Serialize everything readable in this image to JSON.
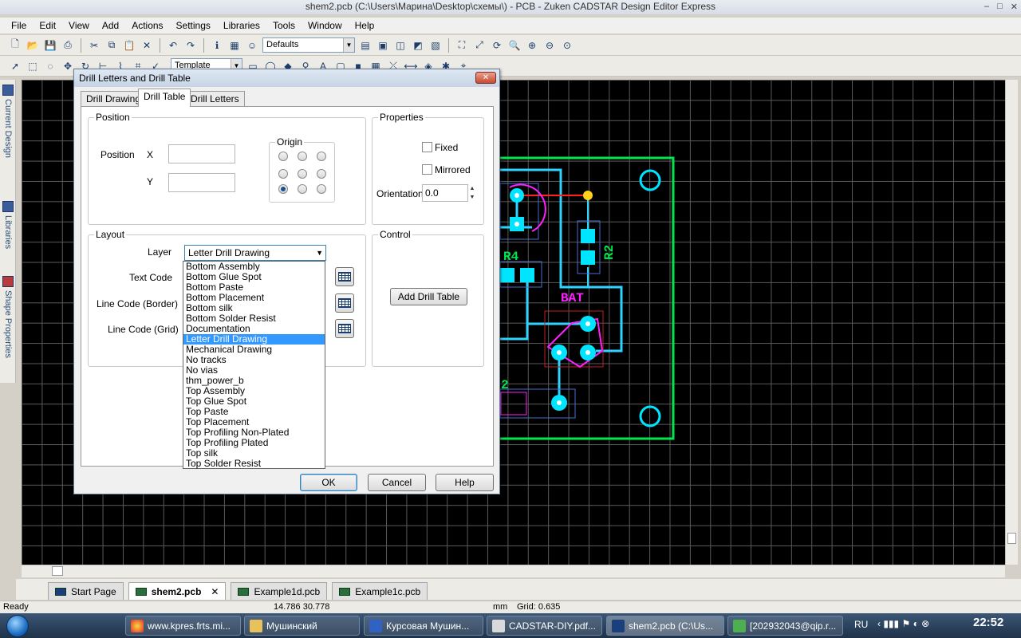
{
  "window": {
    "title": "shem2.pcb (C:\\Users\\Марина\\Desktop\\схемы\\) - PCB - Zuken CADSTAR Design Editor Express",
    "controls": [
      "–",
      "□",
      "✕"
    ]
  },
  "menu": [
    "File",
    "Edit",
    "View",
    "Add",
    "Actions",
    "Settings",
    "Libraries",
    "Tools",
    "Window",
    "Help"
  ],
  "toolbar": {
    "defaults_combo": "Defaults",
    "template_combo": "Template"
  },
  "left_dock": {
    "tabs": [
      "Current Design",
      "Libraries",
      "Shape Properties"
    ]
  },
  "pcb": {
    "labels": [
      "R4",
      "R2",
      "BAT",
      "2"
    ]
  },
  "dialog": {
    "title": "Drill Letters and Drill Table",
    "close": "✕",
    "tabs": [
      "Drill Drawing",
      "Drill Table",
      "Drill Letters"
    ],
    "active_tab": "Drill Table",
    "position": {
      "legend": "Position",
      "label": "Position",
      "x_label": "X",
      "y_label": "Y",
      "x_value": "",
      "y_value": "",
      "origin_legend": "Origin",
      "origin_selected": "bottom-left"
    },
    "properties": {
      "legend": "Properties",
      "fixed": "Fixed",
      "mirrored": "Mirrored",
      "orientation_label": "Orientation",
      "orientation_value": "0.0"
    },
    "layout": {
      "legend": "Layout",
      "layer_label": "Layer",
      "layer_value": "Letter Drill Drawing",
      "text_code_label": "Text Code",
      "line_code_border_label": "Line Code (Border)",
      "line_code_grid_label": "Line Code (Grid)"
    },
    "layer_options": [
      "Bottom Assembly",
      "Bottom Glue Spot",
      "Bottom Paste",
      "Bottom Placement",
      "Bottom silk",
      "Bottom Solder Resist",
      "Documentation",
      "Letter Drill Drawing",
      "Mechanical Drawing",
      "No tracks",
      "No vias",
      "thm_power_b",
      "Top Assembly",
      "Top Glue Spot",
      "Top Paste",
      "Top Placement",
      "Top Profiling Non-Plated",
      "Top Profiling Plated",
      "Top silk",
      "Top Solder Resist"
    ],
    "control": {
      "legend": "Control",
      "add_button": "Add Drill Table"
    },
    "buttons": {
      "ok": "OK",
      "cancel": "Cancel",
      "help": "Help"
    }
  },
  "doc_tabs": [
    "Start Page",
    "shem2.pcb",
    "Example1d.pcb",
    "Example1c.pcb"
  ],
  "doc_tab_close": "✕",
  "status": {
    "ready": "Ready",
    "coords": "14.786  30.778",
    "units": "mm",
    "grid": "Grid: 0.635"
  },
  "taskbar": {
    "items": [
      "www.kpres.frts.mi...",
      "Мушинский",
      "Курсовая Мушин...",
      "CADSTAR-DIY.pdf...",
      "shem2.pcb (C:\\Us...",
      "[202932043@qip.r..."
    ],
    "lang": "RU",
    "clock": "22:52"
  },
  "colors": {
    "board_outline": "#00e64d",
    "pads": "#00e5ff",
    "tracks": "#2fd3ff",
    "red_track": "#ff2020",
    "silk_magenta": "#ff20ff",
    "selection_blue": "#3399ff"
  }
}
